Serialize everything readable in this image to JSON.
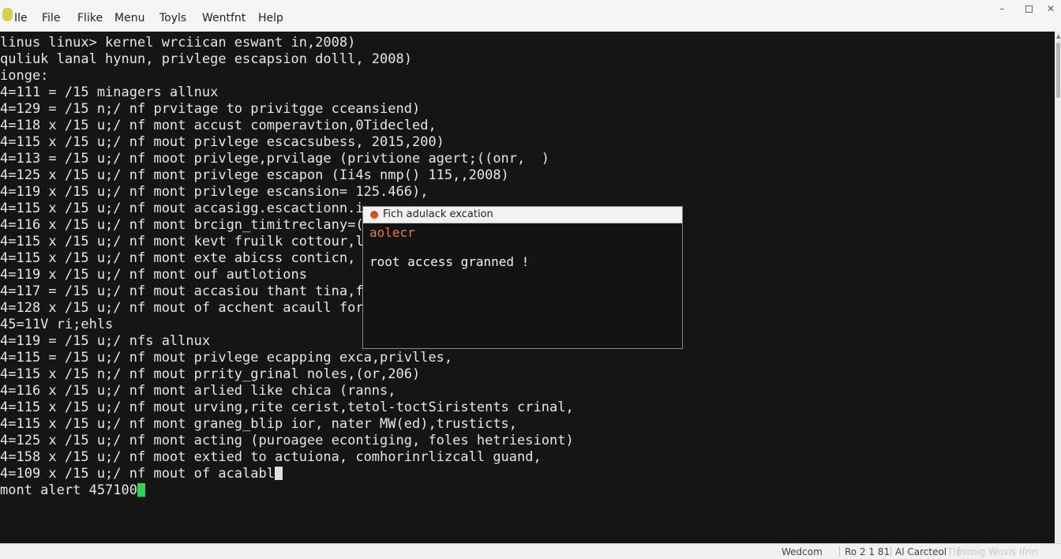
{
  "menubar": {
    "items": [
      "Ile",
      "File",
      "Flike",
      "Menu",
      "Toyls",
      "Wentfnt",
      "Help"
    ]
  },
  "window_controls": {
    "minimize": "–",
    "close": "✕"
  },
  "terminal": {
    "lines": [
      "linus linux> kernel wrciican eswant in,2008)",
      "quliuk lanal hynun, privlege escapsion dolll, 2008)",
      "ionge:",
      "4=111 = /15 minagers allnux",
      "4=129 = /15 n;/ nf prvitage to privitgge cceansiend)",
      "4=118 x /15 u;/ nf mont accust comperavtion,0Tidecled,",
      "4=115 x /15 u;/ nf mout privlege escacsubess, 2015,200)",
      "4=113 = /15 u;/ nf moot privlege,prvilage (privtione agert;((onr,  )",
      "4=125 x /15 u;/ nf mont privlege escapon (Ii4s nmp() 115,,2008)",
      "4=119 x /15 u;/ nf mont privlege escansion= 125.466),",
      "4=115 x /15 u;/ nf mout accasigg.escactionn.i",
      "4=116 x /15 u;/ nf mont brcign_timitreclany=(",
      "4=115 x /15 u;/ nf mont kevt fruilk cottour,l",
      "4=115 x /15 u;/ nf mont exte abicss conticn,",
      "4=119 x /15 u;/ nf mont ouf autlotions",
      "4=117 = /15 u;/ nf mout accasiou thant tina,f",
      "4=128 x /15 u;/ nf mout of acchent acaull for",
      "45=11V ri;ehls",
      "4=119 = /15 u;/ nfs allnux",
      "4=115 = /15 u;/ nf mout privlege ecapping exca,privlles,",
      "4=115 x /15 n;/ nf mout prrity_grinal noles,(or,206)",
      "4=116 x /15 u;/ nf mont arlied like chica (ranns,",
      "4=115 x /15 u;/ nf mout urving,rite cerist,tetol-toctSiristents crinal,",
      "4=115 x /15 u;/ nf mont graneg_blip ior, nater MW(ed),trusticts,",
      "4=125 x /15 u;/ nf mont acting (puroagee econtiging, foles hetriesiont)",
      "4=158 x /15 u;/ nf moot extied to actuiona, comhorinrlizcall guand,",
      "4=109 x /15 u;/ nf mout of acalabl",
      "mont alert 457100"
    ]
  },
  "popup": {
    "title": "Fich adulack excation",
    "heading": "aolecr",
    "message": "root access granned !"
  },
  "statusbar": {
    "items": [
      "Wedcom",
      "Ro 2 1 81",
      "Al Carcteol",
      "Tlmonig Wovis Ifrin"
    ]
  },
  "colors": {
    "terminal_bg": "#151515",
    "terminal_text": "#e6e6e6",
    "popup_heading": "#f07a2c",
    "popup_dot": "#d9501d",
    "cursor_green": "#2fd35a"
  }
}
